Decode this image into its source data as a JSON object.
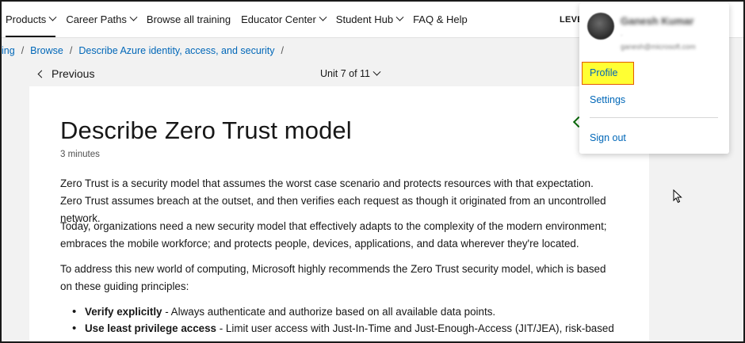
{
  "nav": {
    "items": [
      {
        "label": "Products",
        "has_chevron": true,
        "active": true
      },
      {
        "label": "Career Paths",
        "has_chevron": true,
        "active": false
      },
      {
        "label": "Browse all training",
        "has_chevron": false,
        "active": false
      },
      {
        "label": "Educator Center",
        "has_chevron": true,
        "active": false
      },
      {
        "label": "Student Hub",
        "has_chevron": true,
        "active": false
      },
      {
        "label": "FAQ & Help",
        "has_chevron": false,
        "active": false
      }
    ],
    "level_label": "LEVEL"
  },
  "breadcrumb": {
    "items": [
      "ing",
      "Browse",
      "Describe Azure identity, access, and security"
    ],
    "separator": "/"
  },
  "unit_nav": {
    "previous_label": "Previous",
    "unit_selector": "Unit 7 of 11"
  },
  "article": {
    "title": "Describe Zero Trust model",
    "duration": "3 minutes",
    "paragraphs": [
      "Zero Trust is a security model that assumes the worst case scenario and protects resources with that expectation. Zero Trust assumes breach at the outset, and then verifies each request as though it originated from an uncontrolled network.",
      "Today, organizations need a new security model that effectively adapts to the complexity of the modern environment; embraces the mobile workforce; and protects people, devices, applications, and data wherever they're located.",
      "To address this new world of computing, Microsoft highly recommends the Zero Trust security model, which is based on these guiding principles:"
    ],
    "bullets": [
      {
        "bold": "Verify explicitly",
        "text": " - Always authenticate and authorize based on all available data points."
      },
      {
        "bold": "Use least privilege access",
        "text": " - Limit user access with Just-In-Time and Just-Enough-Access (JIT/JEA), risk-based"
      }
    ]
  },
  "profile_menu": {
    "user_name": "Ganesh Kumar",
    "user_line": "·",
    "user_email": "ganesh@microsoft.com",
    "items": {
      "profile": "Profile",
      "settings": "Settings",
      "sign_out": "Sign out"
    },
    "highlight_color": "#ffff33"
  },
  "colors": {
    "link": "#0067b8",
    "page_bg": "#f2f2f2",
    "text": "#171717"
  }
}
